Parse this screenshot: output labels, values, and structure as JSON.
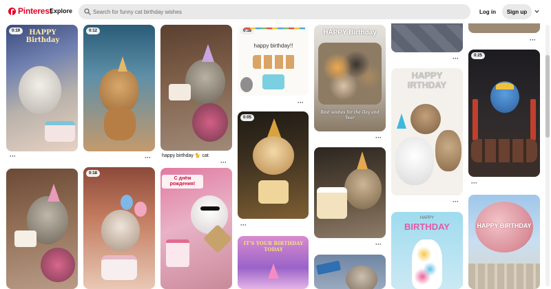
{
  "header": {
    "logo_text": "Pinterest",
    "explore_label": "Explore",
    "search_placeholder": "Search for funny cat birthday wishes",
    "login_label": "Log in",
    "signup_label": "Sign up"
  },
  "colors": {
    "brand": "#e60023",
    "search_bg": "#e9e9e9"
  },
  "pins": [
    {
      "badge": "0:19",
      "overlay": "HAPPY Birthday",
      "icon": "cat-image"
    },
    {
      "badge": "0:12",
      "icon": "bear-image"
    },
    {
      "caption": "happy birthday 🐈 cat",
      "icon": "cat-cake-image"
    },
    {
      "badge": "0:18",
      "overlay": "happy birthday!!",
      "icon": "cats-banner-image"
    },
    {
      "badge": "0:05",
      "icon": "kitten-cake-image"
    },
    {
      "overlay": "HAPPY Birthday",
      "overlay2": "Best wishes for the Day and Year",
      "icon": "cats-group-image"
    },
    {
      "icon": "floor-image"
    },
    {
      "overlay": "HAPPY IRTHDAY",
      "icon": "balloons-cats-image"
    },
    {
      "icon": "top-image"
    },
    {
      "badge": "0:25",
      "icon": "bird-cupcakes-image"
    },
    {
      "icon": "cat-cake-image"
    },
    {
      "badge": "0:18",
      "icon": "kitten-candle-image"
    },
    {
      "overlay": "С днём рождения!",
      "icon": "cat-glasses-image"
    },
    {
      "overlay": "IT'S YOUR BIRTHDAY TODAY",
      "icon": "party-image"
    },
    {
      "icon": "cat-selfie-image"
    },
    {
      "overlay": "HAPPY",
      "overlay2": "BIRTHDAY",
      "icon": "cat-figure-image"
    },
    {
      "overlay": "HAPPY BIRTHDAY",
      "icon": "rose-balloon-image"
    },
    {
      "icon": "cat-hat-image"
    }
  ]
}
